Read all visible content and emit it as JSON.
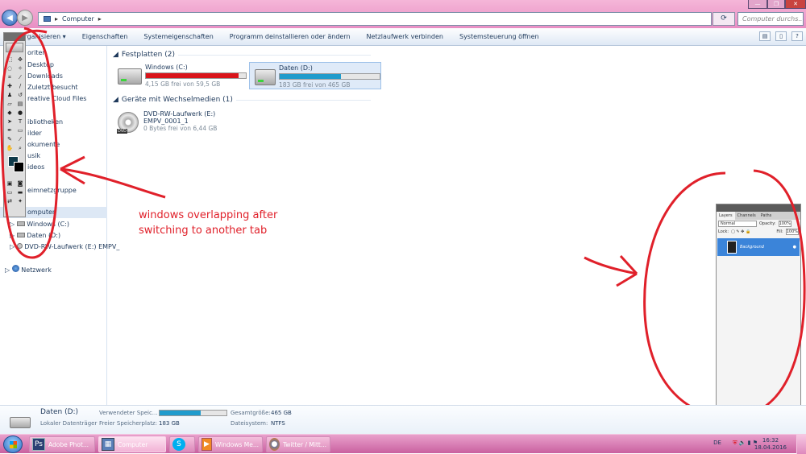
{
  "address": {
    "path": "Computer",
    "search_placeholder": "Computer durchs..."
  },
  "toolbar": {
    "items": [
      "Organisieren ▾",
      "Eigenschaften",
      "Systemeigenschaften",
      "Programm deinstallieren oder ändern",
      "Netzlaufwerk verbinden",
      "Systemsteuerung öffnen"
    ]
  },
  "sidebar": {
    "items": [
      "Favoriten",
      "Desktop",
      "Downloads",
      "Zuletzt besucht",
      "Creative Cloud Files",
      "Bibliotheken",
      "Bilder",
      "Dokumente",
      "Musik",
      "Videos",
      "Heimnetzgruppe",
      "Computer",
      "Windows (C:)",
      "Daten (D:)",
      "DVD-RW-Laufwerk (E:) EMPV_",
      "Netzwerk"
    ],
    "visible": [
      "oriten",
      "Desktop",
      "Downloads",
      "Zuletzt besucht",
      "reative Cloud Files",
      "ibliotheken",
      "ilder",
      "okumente",
      "usik",
      "ideos",
      "eimnetzgruppe",
      "omputer",
      "Windows (C:)",
      "Daten (D:)",
      "DVD-RW-Laufwerk (E:) EMPV_",
      "Netzwerk"
    ]
  },
  "groups": {
    "hdd_title": "Festplatten (2)",
    "removable_title": "Geräte mit Wechselmedien (1)"
  },
  "drives": [
    {
      "name": "Windows (C:)",
      "free": "4,15 GB frei von 59,5 GB",
      "used_fraction": 0.93,
      "color": "#d9141a"
    },
    {
      "name": "Daten (D:)",
      "free": "183 GB frei von 465 GB",
      "used_fraction": 0.61,
      "color": "#1f9bcc"
    }
  ],
  "dvd": {
    "name": "DVD-RW-Laufwerk (E:)",
    "label": "EMPV_0001_1",
    "free": "0 Bytes frei von 6,44 GB",
    "badge": "DVD"
  },
  "annotation": {
    "line1": "windows overlapping after",
    "line2": "switching to another tab"
  },
  "status": {
    "drive_name": "Daten (D:)",
    "drive_type": "Lokaler Datenträger",
    "used_label": "Verwendeter Speic...",
    "free_label": "Freier Speicherplatz:",
    "free_value": "183 GB",
    "total_label": "Gesamtgröße:",
    "total_value": "465 GB",
    "fs_label": "Dateisystem:",
    "fs_value": "NTFS",
    "used_fraction": 0.61
  },
  "taskbar": {
    "items": [
      "Adobe Phot...",
      "Computer",
      "",
      "Windows Me...",
      "Twitter / Mitt..."
    ],
    "lang": "DE",
    "time": "16:32",
    "date": "18.04.2016"
  },
  "photoshop_layers": {
    "tabs": [
      "Layers",
      "Channels",
      "Paths"
    ],
    "blend": "Normal",
    "opacity_label": "Opacity:",
    "opacity": "100%",
    "lock_label": "Lock:",
    "fill_label": "Fill:",
    "fill": "100%",
    "layer_name": "Background"
  },
  "colors": {
    "accent_red": "#e0202a",
    "taskbar": "#c9619f",
    "selection": "#3b84d9"
  }
}
